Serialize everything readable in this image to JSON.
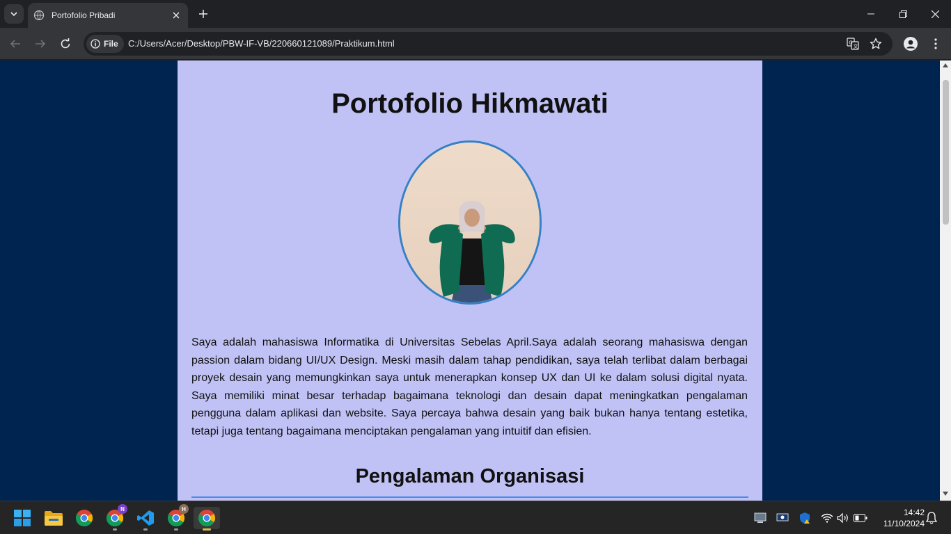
{
  "browser": {
    "tab_title": "Portofolio Pribadi",
    "chip_label": "File",
    "url": "C:/Users/Acer/Desktop/PBW-IF-VB/220660121089/Praktikum.html"
  },
  "page": {
    "heading": "Portofolio Hikmawati",
    "bio": "Saya adalah mahasiswa Informatika di Universitas Sebelas April.Saya adalah seorang mahasiswa dengan passion dalam bidang UI/UX Design. Meski masih dalam tahap pendidikan, saya telah terlibat dalam berbagai proyek desain yang memungkinkan saya untuk menerapkan konsep UX dan UI ke dalam solusi digital nyata. Saya memiliki minat besar terhadap bagaimana teknologi dan desain dapat meningkatkan pengalaman pengguna dalam aplikasi dan website. Saya percaya bahwa desain yang baik bukan hanya tentang estetika, tetapi juga tentang bagaimana menciptakan pengalaman yang intuitif dan efisien.",
    "section_heading": "Pengalaman Organisasi",
    "colors": {
      "card_bg": "#c0c2f5",
      "page_bg": "#002450",
      "accent": "#4d8ae8"
    }
  },
  "taskbar": {
    "badges": {
      "chrome_profile_n": "N",
      "chrome_profile_h": "H"
    },
    "time": "14:42",
    "date": "11/10/2024"
  }
}
